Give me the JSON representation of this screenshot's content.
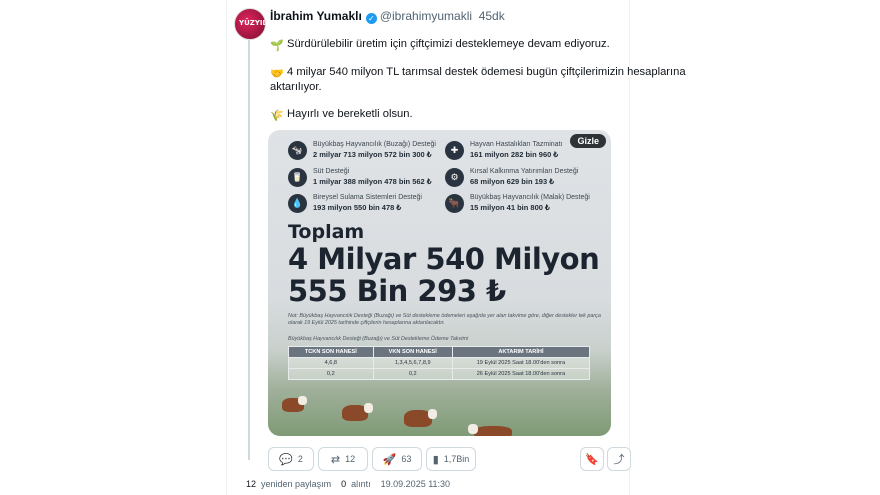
{
  "author": {
    "name": "İbrahim Yumaklı",
    "handle": "@ibrahimyumakli",
    "time": "45dk",
    "avatar_text": "YÜZYIL"
  },
  "tweet": {
    "line1": "Sürdürülebilir üretim için çiftçimizi desteklemeye devam ediyoruz.",
    "line2a": "4 milyar 540 milyon TL tarımsal destek ödemesi bugün çiftçilerimizin hesaplarına",
    "line2b": "aktarılıyor.",
    "line3": "Hayırlı ve bereketli olsun."
  },
  "infographic": {
    "hide_label": "Gizle",
    "items": [
      {
        "label": "Büyükbaş Hayvancılık (Buzağı) Desteği",
        "amount": "2 milyar 713 milyon 572 bin  300 ₺",
        "icon": "cow-icon"
      },
      {
        "label": "Süt Desteği",
        "amount": "1 milyar 388 milyon 478 bin  562 ₺",
        "icon": "milk-icon"
      },
      {
        "label": "Bireysel Sulama Sistemleri Desteği",
        "amount": "193 milyon 550 bin  478 ₺",
        "icon": "irrigation-icon"
      },
      {
        "label": "Hayvan Hastalıkları Tazminatı",
        "amount": "161 milyon 282 bin 960 ₺",
        "icon": "vet-icon"
      },
      {
        "label": "Kırsal Kalkınma Yatırımları Desteği",
        "amount": "68 milyon 629 bin 193 ₺",
        "icon": "gear-icon"
      },
      {
        "label": "Büyükbaş Hayvancılık (Malak) Desteği",
        "amount": "15 milyon 41 bin 800 ₺",
        "icon": "calf-icon"
      }
    ],
    "total_label": "Toplam",
    "total_line1": "4 Milyar 540 Milyon",
    "total_line2": "555 Bin  293 ₺",
    "note": "Not: Büyükbaş Hayvancılık Desteği (Buzağı) ve Süt destekleme ödemeleri aşağıda yer alan takvime göre, diğer destekler tek parça olarak 19 Eylül 2025 tarihinde çiftçilerin hesaplarına aktarılacaktır.",
    "schedule_title": "Büyükbaş Hayvancılık Desteği (Buzağı) ve Süt Destekleme Ödeme Takvimi",
    "table": {
      "headers": [
        "TCKN SON HANESİ",
        "VKN SON HANESİ",
        "AKTARIM TARİHİ"
      ],
      "rows": [
        [
          "4,6,8",
          "1,3,4,5,6,7,8,9",
          "19 Eylül 2025 Saat 18.00'den sonra"
        ],
        [
          "0,2",
          "0,2",
          "26 Eylül 2025 Saat 18.00'den sonra"
        ]
      ]
    }
  },
  "actions": {
    "replies": "2",
    "retweets": "12",
    "likes": "63",
    "views": "1,7Bin"
  },
  "stats": {
    "retweet_count": "12",
    "retweet_label": "yeniden paylaşım",
    "quote_count": "0",
    "quote_label": "alıntı",
    "datetime": "19.09.2025 11:30"
  }
}
